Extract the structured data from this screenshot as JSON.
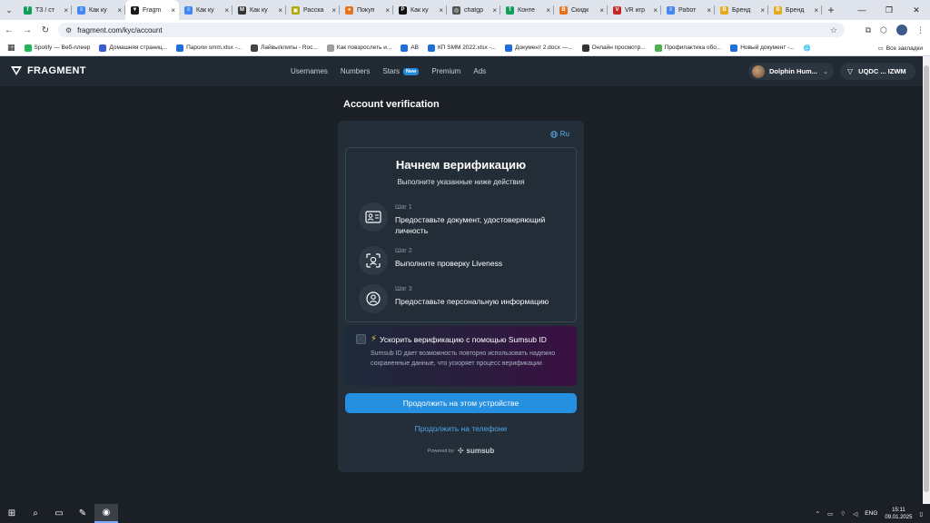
{
  "browser": {
    "tabs": [
      {
        "title": "ТЗ / ст",
        "color": "#0f9d58",
        "glyph": "T",
        "active": false
      },
      {
        "title": "Как ку",
        "color": "#4285f4",
        "glyph": "≡",
        "active": false
      },
      {
        "title": "Fragm",
        "color": "#1a1a1a",
        "glyph": "▼",
        "active": true
      },
      {
        "title": "Как ку",
        "color": "#4285f4",
        "glyph": "≡",
        "active": false
      },
      {
        "title": "Как ку",
        "color": "#333333",
        "glyph": "M",
        "active": false
      },
      {
        "title": "Расска",
        "color": "#b3a800",
        "glyph": "▣",
        "active": false
      },
      {
        "title": "Покуп",
        "color": "#e8711c",
        "glyph": "●",
        "active": false
      },
      {
        "title": "Как ку",
        "color": "#111111",
        "glyph": "P",
        "active": false
      },
      {
        "title": "chatgp",
        "color": "#555555",
        "glyph": "◎",
        "active": false
      },
      {
        "title": "Конте",
        "color": "#0f9d58",
        "glyph": "T",
        "active": false
      },
      {
        "title": "Скидк",
        "color": "#e8711c",
        "glyph": "B",
        "active": false
      },
      {
        "title": "VR игр",
        "color": "#c62828",
        "glyph": "V",
        "active": false
      },
      {
        "title": "Работ",
        "color": "#4285f4",
        "glyph": "≡",
        "active": false
      },
      {
        "title": "Бренд",
        "color": "#e8a81c",
        "glyph": "B",
        "active": false
      },
      {
        "title": "Бренд",
        "color": "#e8a81c",
        "glyph": "B",
        "active": false
      }
    ],
    "url": "fragment.com/kyc/account",
    "bookmarks": [
      {
        "label": "Spotify — Веб-плеер",
        "color": "#1db954"
      },
      {
        "label": "Домашняя страниц...",
        "color": "#3b5bdb"
      },
      {
        "label": "Пароли smm.xlsx -...",
        "color": "#1e6fd9"
      },
      {
        "label": "Лайвы/клипы - Roc...",
        "color": "#444444"
      },
      {
        "label": "Как повзрослеть и...",
        "color": "#9e9e9e"
      },
      {
        "label": "AB",
        "color": "#1e6fd9"
      },
      {
        "label": "КП SMM 2022.xlsx -...",
        "color": "#1e6fd9"
      },
      {
        "label": "Документ 2.docx —...",
        "color": "#1e6fd9"
      },
      {
        "label": "Онлайн просмотр...",
        "color": "#333333"
      },
      {
        "label": "Профилактика обо...",
        "color": "#4caf50"
      },
      {
        "label": "Новый документ -...",
        "color": "#1e6fd9"
      }
    ],
    "all_bookmarks": "Все закладки"
  },
  "header": {
    "logo": "FRAGMENT",
    "nav": [
      {
        "label": "Usernames"
      },
      {
        "label": "Numbers"
      },
      {
        "label": "Stars",
        "badge": "New"
      },
      {
        "label": "Premium"
      },
      {
        "label": "Ads"
      }
    ],
    "user_name": "Dolphin Hum...",
    "wallet": "UQDC ... IZWM"
  },
  "main": {
    "page_title": "Account verification",
    "language": "Ru",
    "heading": "Начнем верификацию",
    "subheading": "Выполните указанные ниже действия",
    "steps": [
      {
        "label": "Шаг 1",
        "desc": "Предоставьте документ, удостоверяющий личность",
        "icon": "id-card-icon"
      },
      {
        "label": "Шаг 2",
        "desc": "Выполните проверку Liveness",
        "icon": "face-scan-icon"
      },
      {
        "label": "Шаг 3",
        "desc": "Предоставьте персональную информацию",
        "icon": "user-circle-icon"
      }
    ],
    "sumsub_title": "Ускорить верификацию с помощью Sumsub ID",
    "sumsub_desc": "Sumsub ID дает возможность повторно использовать надежно сохраненные данные, что ускоряет процесс верификации",
    "continue_device": "Продолжить на этом устройстве",
    "continue_phone": "Продолжить на телефоне",
    "powered_by": "Powered by",
    "powered_brand": "sumsub"
  },
  "taskbar": {
    "lang": "ENG",
    "time": "15:11",
    "date": "09.01.2025"
  },
  "colors": {
    "accent": "#2690e0",
    "panel": "#232e38",
    "background": "#1a2026"
  }
}
